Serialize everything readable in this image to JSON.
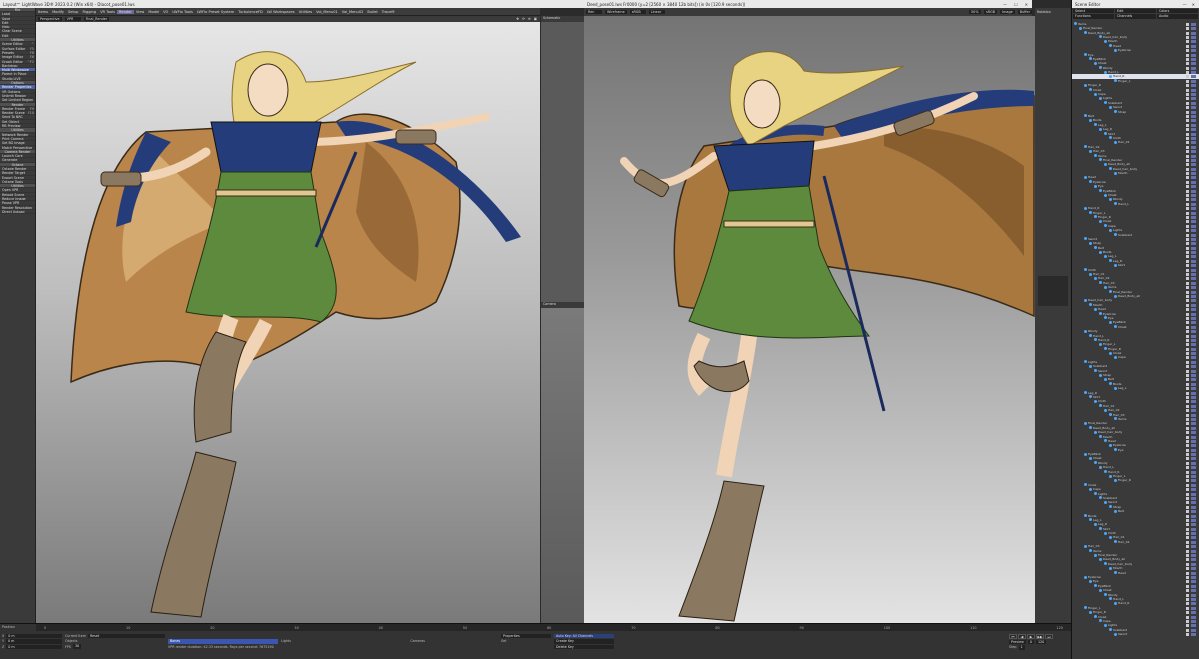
{
  "app": {
    "title": "Layout™ LightWave 3D® 2023.0.2 (Win x64) - Dlacot_pose01.lws",
    "menu": [
      "Items",
      "Modify",
      "Setup",
      "Rigging",
      "VR Tools",
      "Render",
      "View",
      "Model",
      "VO",
      "LWFlo Tools",
      "LWFlo Preset System",
      "TurbulenceFD",
      "LW Workspaces",
      "Utilities",
      "Vol_Menu01",
      "Vol_Menu02",
      "Bullet",
      "TraceM"
    ],
    "active_menu": "Render"
  },
  "left_panel": {
    "top_buttons": [
      "File",
      "Load",
      "Save",
      "Edit",
      "Help",
      "Clear Scene",
      "Edit"
    ],
    "sections": [
      {
        "header": "Utilities",
        "items": [
          [
            "Scene Editor",
            "^"
          ],
          [
            "Surface Editor",
            "F5"
          ],
          [
            "Presets",
            "F8"
          ],
          [
            "Image Editor",
            "F6"
          ],
          [
            "Graph Editor",
            "^F2"
          ],
          [
            "Backdrop",
            ""
          ]
        ]
      },
      {
        "header": "",
        "items": [
          [
            "Multi Windowize",
            ""
          ],
          [
            "Parent in Place",
            ""
          ],
          [
            "Studio LIVE",
            ""
          ]
        ]
      },
      {
        "header": "Options",
        "items": [
          [
            "Render Properties",
            ""
          ],
          [
            "VR Options",
            ""
          ],
          [
            "Unlimit Region",
            ""
          ],
          [
            "Set Limited Region",
            ""
          ]
        ]
      },
      {
        "header": "Render",
        "items": [
          [
            "Render Frame",
            "F9"
          ],
          [
            "Render Scene",
            "F10"
          ],
          [
            "Send To NRC",
            ""
          ],
          [
            "Set Object",
            ""
          ],
          [
            "RB Preview",
            ""
          ]
        ]
      },
      {
        "header": "Utilities",
        "items": [
          [
            "Network Render",
            ""
          ],
          [
            "Print Camera",
            ""
          ],
          [
            "Set BG Image",
            ""
          ],
          [
            "Match Perspective",
            ""
          ]
        ]
      },
      {
        "header": "Camera Render",
        "items": [
          [
            "Launch Core",
            ""
          ],
          [
            "Generate",
            ""
          ]
        ]
      },
      {
        "header": "Octane",
        "items": [
          [
            "Octane Render",
            ""
          ],
          [
            "Render Target",
            ""
          ],
          [
            "Export Scene",
            ""
          ],
          [
            "Octane Tools",
            ""
          ]
        ]
      },
      {
        "header": "Utilities",
        "items": [
          [
            "Open VPR",
            ""
          ],
          [
            "Reload Scene",
            ""
          ],
          [
            "Reduce Image",
            ""
          ],
          [
            "Pause VPR",
            ""
          ],
          [
            "Render Resolution",
            ""
          ],
          [
            "Direct Upload",
            ""
          ]
        ]
      }
    ]
  },
  "viewport": {
    "view_mode": "Perspective",
    "shading": "VPR",
    "camera": "Final_Render",
    "secondary_label": "Schematic",
    "camera_label": "Camera"
  },
  "render_window": {
    "title": "Deed_pose01.lws Fr0000 (y=2 [2560 × 3840 12b bits]) (in 0s [120.9 seconds])",
    "toolbar": [
      "Ren",
      "Wireframe",
      "sRGB",
      "Linear"
    ],
    "right_toolbar": [
      "50%",
      "sRGB",
      "Image",
      "Buffer"
    ],
    "right_tab": "Rotation"
  },
  "scene_editor": {
    "title": "Scene Editor",
    "toolbar": [
      "Select",
      "Edit",
      "Colors",
      "Functions",
      "Channels",
      "Audio"
    ],
    "nodes": [
      "Items",
      "Final_Render",
      "Deed_Body_all",
      "Deed_hair_body",
      "Mouth",
      "Head",
      "Eyebrow",
      "Eye",
      "EyeBlink",
      "Chest",
      "Rbody",
      "Hand_L",
      "Hand_R",
      "Finger_L",
      "Finger_R",
      "Cloak",
      "Cape",
      "Lights",
      "Scabbard",
      "Sword",
      "Strap",
      "Belt",
      "Boots",
      "Leg_L",
      "Leg_R",
      "Skirt",
      "Cloth",
      "Hair_01",
      "Hair_02",
      "Hair_03"
    ],
    "highlighted_index": 12
  },
  "timeline": {
    "label_left": "Position",
    "ticks": [
      "0",
      "10",
      "20",
      "30",
      "40",
      "50",
      "60",
      "70",
      "80",
      "90",
      "100",
      "110",
      "120"
    ],
    "current_item_label": "Current Item",
    "current_item": "Reset",
    "objects_label": "Objects",
    "object_value": "Bones",
    "lights_label": "Lights",
    "cameras_label": "Cameras",
    "properties_label": "Properties",
    "set_label": "Set",
    "auto_key": "Auto Key: All Channels",
    "create_key": "Create Key",
    "delete_key": "Delete Key",
    "status": "VPR render duration: 42.33 seconds. Rays per second: 7675190",
    "fps_label": "FPS",
    "fps_value": "30",
    "grid": "100 mm",
    "preview_label": "Preview",
    "step_label": "Step",
    "step_value": "1",
    "coords": [
      [
        "X",
        "0 m"
      ],
      [
        "Y",
        "0 m"
      ],
      [
        "Z",
        "0 m"
      ]
    ],
    "frame_start": "0",
    "frame_end": "120"
  }
}
